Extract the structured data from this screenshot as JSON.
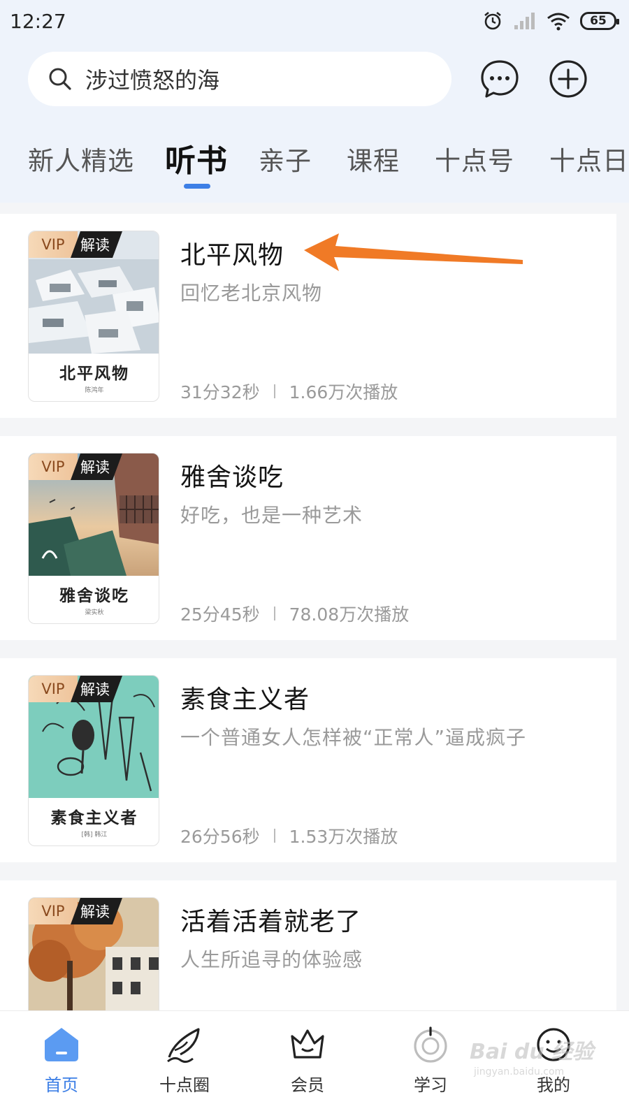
{
  "status_bar": {
    "time": "12:27",
    "battery": "65"
  },
  "search": {
    "text": "涉过愤怒的海"
  },
  "tabs": [
    {
      "label": "新人精选"
    },
    {
      "label": "听书"
    },
    {
      "label": "亲子"
    },
    {
      "label": "课程"
    },
    {
      "label": "十点号"
    },
    {
      "label": "十点日"
    }
  ],
  "badge": {
    "vip": "VIP",
    "read": "解读"
  },
  "items": [
    {
      "title": "北平风物",
      "subtitle": "回忆老北京风物",
      "duration": "31分32秒",
      "plays": "1.66万次播放",
      "cover_title": "北平风物",
      "cover_author": "陈鸿年"
    },
    {
      "title": "雅舍谈吃",
      "subtitle": "好吃，也是一种艺术",
      "duration": "25分45秒",
      "plays": "78.08万次播放",
      "cover_title": "雅舍谈吃",
      "cover_author": "梁实秋"
    },
    {
      "title": "素食主义者",
      "subtitle": "一个普通女人怎样被“正常人”逼成疯子",
      "duration": "26分56秒",
      "plays": "1.53万次播放",
      "cover_title": "素食主义者",
      "cover_author": "[韩] 韩江"
    },
    {
      "title": "活着活着就老了",
      "subtitle": "人生所追寻的体验感",
      "duration": "",
      "plays": ""
    }
  ],
  "bottom_nav": [
    {
      "label": "首页",
      "icon": "home-icon",
      "active": true
    },
    {
      "label": "十点圈",
      "icon": "feather-icon"
    },
    {
      "label": "会员",
      "icon": "crown-icon"
    },
    {
      "label": "学习",
      "icon": "learn-icon"
    },
    {
      "label": "我的",
      "icon": "profile-icon"
    }
  ],
  "watermark": {
    "main": "Bai du 经验",
    "sub": "jingyan.baidu.com"
  },
  "colors": {
    "accent": "#3d7fe6",
    "arrow": "#f07a26",
    "header_bg": "#eef3fb"
  }
}
